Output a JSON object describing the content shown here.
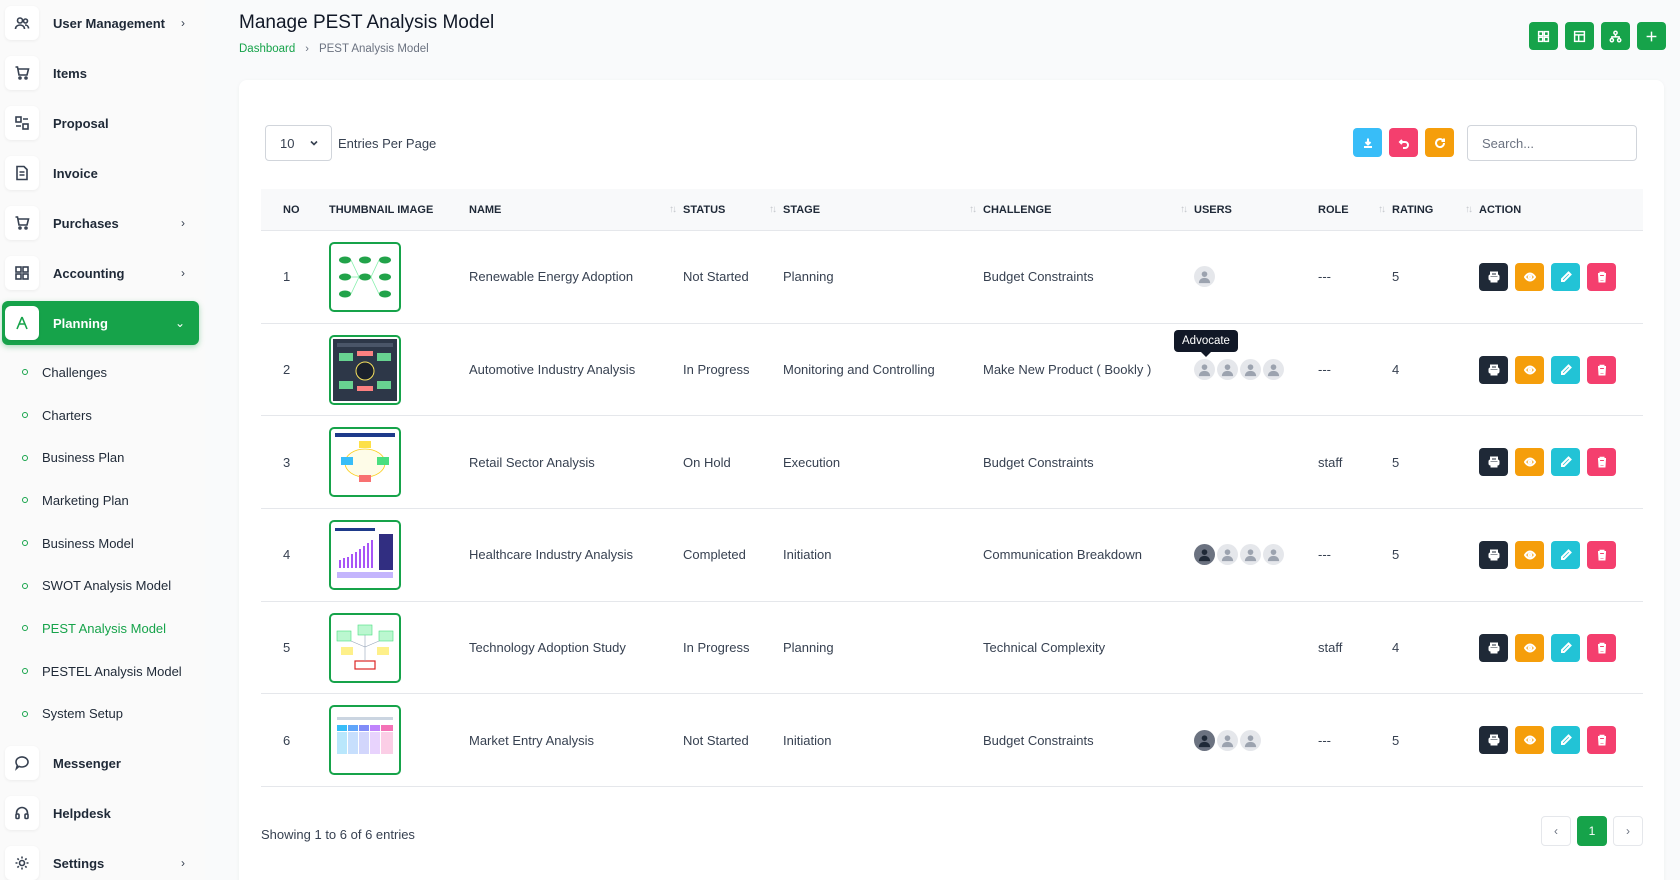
{
  "colors": {
    "accent": "#16a34a",
    "btn_dark": "#1f2937",
    "btn_orange": "#f59e0b",
    "btn_cyan": "#22c3d6",
    "btn_pink": "#f43f6e",
    "btn_download": "#38bdf8"
  },
  "sidebar": {
    "items": [
      {
        "label": "User Management",
        "icon": "users-icon",
        "chevron": "›"
      },
      {
        "label": "Items",
        "icon": "cart-icon"
      },
      {
        "label": "Proposal",
        "icon": "proposal-icon"
      },
      {
        "label": "Invoice",
        "icon": "invoice-icon"
      },
      {
        "label": "Purchases",
        "icon": "cart-icon",
        "chevron": "›"
      },
      {
        "label": "Accounting",
        "icon": "grid-icon",
        "chevron": "›"
      },
      {
        "label": "Planning",
        "icon": "planning-icon",
        "chevron": "⌄",
        "active": true
      }
    ],
    "submenu": [
      {
        "label": "Challenges"
      },
      {
        "label": "Charters"
      },
      {
        "label": "Business Plan"
      },
      {
        "label": "Marketing Plan"
      },
      {
        "label": "Business Model"
      },
      {
        "label": "SWOT Analysis Model"
      },
      {
        "label": "PEST Analysis Model",
        "active": true
      },
      {
        "label": "PESTEL Analysis Model"
      },
      {
        "label": "System Setup"
      }
    ],
    "bottom_items": [
      {
        "label": "Messenger",
        "icon": "chat-icon"
      },
      {
        "label": "Helpdesk",
        "icon": "headset-icon"
      },
      {
        "label": "Settings",
        "icon": "gear-icon",
        "chevron": "›"
      }
    ]
  },
  "header": {
    "title": "Manage PEST Analysis Model",
    "breadcrumb": {
      "home": "Dashboard",
      "sep": "›",
      "current": "PEST Analysis Model"
    },
    "action_icons": [
      "grid-icon",
      "table-icon",
      "hierarchy-icon",
      "plus-icon"
    ]
  },
  "toolbar": {
    "per_page_value": "10",
    "per_page_label": "Entries Per Page",
    "search_placeholder": "Search...",
    "tool_icons": [
      "download-icon",
      "undo-icon",
      "refresh-icon"
    ]
  },
  "table": {
    "columns": {
      "no": "NO",
      "thumb": "THUMBNAIL IMAGE",
      "name": "NAME",
      "status": "STATUS",
      "stage": "STAGE",
      "challenge": "CHALLENGE",
      "users": "USERS",
      "role": "ROLE",
      "rating": "RATING",
      "action": "ACTION"
    },
    "sort_glyph": "↑↓",
    "rows": [
      {
        "no": "1",
        "name": "Renewable Energy Adoption",
        "status": "Not Started",
        "stage": "Planning",
        "challenge": "Budget Constraints",
        "role": "---",
        "rating": "5",
        "users": [
          "default"
        ]
      },
      {
        "no": "2",
        "name": "Automotive Industry Analysis",
        "status": "In Progress",
        "stage": "Monitoring and Controlling",
        "challenge": "Make New Product ( Bookly )",
        "role": "---",
        "rating": "4",
        "users": [
          "default",
          "default",
          "default",
          "default"
        ]
      },
      {
        "no": "3",
        "name": "Retail Sector Analysis",
        "status": "On Hold",
        "stage": "Execution",
        "challenge": "Budget Constraints",
        "role": "staff",
        "rating": "5",
        "users": []
      },
      {
        "no": "4",
        "name": "Healthcare Industry Analysis",
        "status": "Completed",
        "stage": "Initiation",
        "challenge": "Communication Breakdown",
        "role": "---",
        "rating": "5",
        "users": [
          "photo",
          "default",
          "default",
          "default"
        ]
      },
      {
        "no": "5",
        "name": "Technology Adoption Study",
        "status": "In Progress",
        "stage": "Planning",
        "challenge": "Technical Complexity",
        "role": "staff",
        "rating": "4",
        "users": []
      },
      {
        "no": "6",
        "name": "Market Entry Analysis",
        "status": "Not Started",
        "stage": "Initiation",
        "challenge": "Budget Constraints",
        "role": "---",
        "rating": "5",
        "users": [
          "photo",
          "default",
          "default"
        ]
      }
    ],
    "row_action_icons": [
      "print-icon",
      "eye-icon",
      "edit-icon",
      "trash-icon"
    ]
  },
  "tooltip": "Advocate",
  "footer": {
    "info": "Showing 1 to 6 of 6 entries",
    "prev": "‹",
    "current_page": "1",
    "next": "›"
  }
}
